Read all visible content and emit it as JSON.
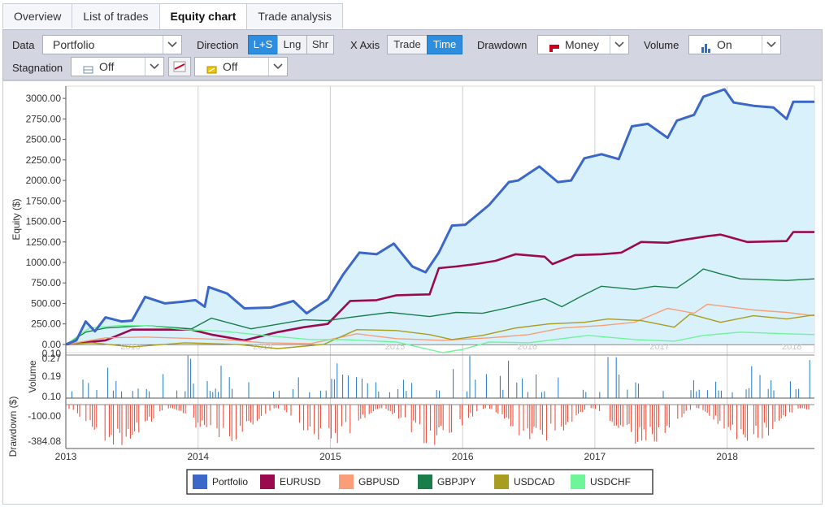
{
  "tabs": [
    {
      "label": "Overview",
      "active": false
    },
    {
      "label": "List of trades",
      "active": false
    },
    {
      "label": "Equity chart",
      "active": true
    },
    {
      "label": "Trade analysis",
      "active": false
    }
  ],
  "toolbar": {
    "data_label": "Data",
    "data_value": "Portfolio",
    "direction_label": "Direction",
    "direction_options": [
      "L+S",
      "Lng",
      "Shr"
    ],
    "direction_selected": "L+S",
    "xaxis_label": "X Axis",
    "xaxis_options": [
      "Trade",
      "Time"
    ],
    "xaxis_selected": "Time",
    "drawdown_label": "Drawdown",
    "drawdown_value": "Money",
    "volume_label": "Volume",
    "volume_value": "On",
    "stagnation_label": "Stagnation",
    "stagnation_value": "Off",
    "trend_value": "Off",
    "colors": {
      "selected": "#2d8ee0"
    }
  },
  "chart_data": [
    {
      "type": "area",
      "ylabel": "Equity ($)",
      "y_ticks": [
        "0.00",
        "250.00",
        "500.00",
        "750.00",
        "1000.00",
        "1250.00",
        "1500.00",
        "1750.00",
        "2000.00",
        "2250.00",
        "2500.00",
        "2750.00",
        "3000.00"
      ],
      "ylim": [
        -100,
        3150
      ],
      "xlim": [
        2013.0,
        2018.66
      ],
      "x_ticks": [
        "2013",
        "2014",
        "2015",
        "2016",
        "2017",
        "2018"
      ],
      "x_year_values": [
        2013,
        2014,
        2015,
        2016,
        2017,
        2018
      ],
      "watermark_labels": [
        "2013",
        "2014",
        "2015",
        "2016",
        "2017",
        "2018"
      ],
      "grid": true,
      "legend_position": "bottom-center",
      "series": [
        {
          "name": "Portfolio",
          "color": "#3a67c8",
          "points": [
            [
              2013.0,
              0
            ],
            [
              2013.08,
              50
            ],
            [
              2013.15,
              280
            ],
            [
              2013.22,
              160
            ],
            [
              2013.3,
              330
            ],
            [
              2013.42,
              280
            ],
            [
              2013.5,
              290
            ],
            [
              2013.6,
              580
            ],
            [
              2013.75,
              500
            ],
            [
              2013.88,
              520
            ],
            [
              2013.98,
              540
            ],
            [
              2014.05,
              460
            ],
            [
              2014.08,
              700
            ],
            [
              2014.22,
              620
            ],
            [
              2014.35,
              440
            ],
            [
              2014.55,
              450
            ],
            [
              2014.72,
              530
            ],
            [
              2014.82,
              380
            ],
            [
              2014.98,
              550
            ],
            [
              2015.1,
              860
            ],
            [
              2015.22,
              1120
            ],
            [
              2015.35,
              1100
            ],
            [
              2015.48,
              1230
            ],
            [
              2015.62,
              950
            ],
            [
              2015.72,
              880
            ],
            [
              2015.82,
              1120
            ],
            [
              2015.92,
              1450
            ],
            [
              2016.02,
              1460
            ],
            [
              2016.2,
              1700
            ],
            [
              2016.35,
              1980
            ],
            [
              2016.42,
              2000
            ],
            [
              2016.58,
              2170
            ],
            [
              2016.72,
              1980
            ],
            [
              2016.82,
              2000
            ],
            [
              2016.92,
              2270
            ],
            [
              2017.05,
              2320
            ],
            [
              2017.18,
              2260
            ],
            [
              2017.28,
              2660
            ],
            [
              2017.4,
              2690
            ],
            [
              2017.55,
              2520
            ],
            [
              2017.62,
              2730
            ],
            [
              2017.75,
              2800
            ],
            [
              2017.82,
              3020
            ],
            [
              2017.98,
              3110
            ],
            [
              2018.05,
              2950
            ],
            [
              2018.2,
              2910
            ],
            [
              2018.35,
              2890
            ],
            [
              2018.45,
              2750
            ],
            [
              2018.5,
              2960
            ],
            [
              2018.66,
              2960
            ]
          ]
        },
        {
          "name": "EURUSD",
          "color": "#9b0a4f",
          "points": [
            [
              2013.0,
              0
            ],
            [
              2013.3,
              50
            ],
            [
              2013.5,
              180
            ],
            [
              2013.95,
              180
            ],
            [
              2014.1,
              120
            ],
            [
              2014.35,
              50
            ],
            [
              2014.6,
              150
            ],
            [
              2014.8,
              210
            ],
            [
              2014.98,
              250
            ],
            [
              2015.15,
              530
            ],
            [
              2015.35,
              540
            ],
            [
              2015.5,
              600
            ],
            [
              2015.75,
              610
            ],
            [
              2015.82,
              930
            ],
            [
              2015.95,
              950
            ],
            [
              2016.1,
              980
            ],
            [
              2016.25,
              1020
            ],
            [
              2016.4,
              1100
            ],
            [
              2016.62,
              1070
            ],
            [
              2016.68,
              980
            ],
            [
              2016.85,
              1090
            ],
            [
              2017.05,
              1100
            ],
            [
              2017.2,
              1120
            ],
            [
              2017.35,
              1250
            ],
            [
              2017.55,
              1240
            ],
            [
              2017.65,
              1270
            ],
            [
              2017.85,
              1320
            ],
            [
              2017.95,
              1340
            ],
            [
              2018.15,
              1250
            ],
            [
              2018.45,
              1260
            ],
            [
              2018.5,
              1370
            ],
            [
              2018.66,
              1370
            ]
          ]
        },
        {
          "name": "GBPUSD",
          "color": "#f99e78",
          "points": [
            [
              2013.0,
              0
            ],
            [
              2013.3,
              80
            ],
            [
              2013.6,
              90
            ],
            [
              2014.2,
              60
            ],
            [
              2014.5,
              20
            ],
            [
              2014.85,
              10
            ],
            [
              2015.2,
              130
            ],
            [
              2015.5,
              70
            ],
            [
              2015.85,
              50
            ],
            [
              2016.2,
              80
            ],
            [
              2016.5,
              120
            ],
            [
              2016.75,
              200
            ],
            [
              2017.05,
              230
            ],
            [
              2017.3,
              270
            ],
            [
              2017.55,
              440
            ],
            [
              2017.75,
              380
            ],
            [
              2017.85,
              490
            ],
            [
              2018.2,
              420
            ],
            [
              2018.45,
              390
            ],
            [
              2018.66,
              350
            ]
          ]
        },
        {
          "name": "GBPJPY",
          "color": "#1a7e4b",
          "points": [
            [
              2013.0,
              0
            ],
            [
              2013.15,
              150
            ],
            [
              2013.3,
              200
            ],
            [
              2013.6,
              230
            ],
            [
              2013.95,
              190
            ],
            [
              2014.1,
              320
            ],
            [
              2014.4,
              190
            ],
            [
              2014.8,
              300
            ],
            [
              2014.98,
              290
            ],
            [
              2015.15,
              330
            ],
            [
              2015.45,
              390
            ],
            [
              2015.75,
              340
            ],
            [
              2015.95,
              390
            ],
            [
              2016.15,
              380
            ],
            [
              2016.35,
              450
            ],
            [
              2016.62,
              560
            ],
            [
              2016.75,
              460
            ],
            [
              2016.9,
              590
            ],
            [
              2017.05,
              710
            ],
            [
              2017.3,
              670
            ],
            [
              2017.45,
              710
            ],
            [
              2017.62,
              690
            ],
            [
              2017.75,
              830
            ],
            [
              2017.82,
              920
            ],
            [
              2017.95,
              860
            ],
            [
              2018.1,
              800
            ],
            [
              2018.45,
              780
            ],
            [
              2018.66,
              800
            ]
          ]
        },
        {
          "name": "USDCAD",
          "color": "#a89d1e",
          "points": [
            [
              2013.0,
              0
            ],
            [
              2013.2,
              20
            ],
            [
              2013.5,
              -30
            ],
            [
              2013.9,
              20
            ],
            [
              2014.3,
              0
            ],
            [
              2014.6,
              -50
            ],
            [
              2014.95,
              0
            ],
            [
              2015.2,
              180
            ],
            [
              2015.5,
              170
            ],
            [
              2015.75,
              120
            ],
            [
              2015.92,
              60
            ],
            [
              2016.15,
              110
            ],
            [
              2016.4,
              200
            ],
            [
              2016.65,
              250
            ],
            [
              2016.92,
              270
            ],
            [
              2017.1,
              310
            ],
            [
              2017.35,
              290
            ],
            [
              2017.6,
              210
            ],
            [
              2017.72,
              370
            ],
            [
              2017.95,
              270
            ],
            [
              2018.2,
              350
            ],
            [
              2018.45,
              310
            ],
            [
              2018.66,
              360
            ]
          ]
        },
        {
          "name": "USDCHF",
          "color": "#6ef59a",
          "points": [
            [
              2013.0,
              0
            ],
            [
              2013.18,
              200
            ],
            [
              2013.4,
              230
            ],
            [
              2013.6,
              230
            ],
            [
              2013.9,
              180
            ],
            [
              2014.2,
              160
            ],
            [
              2014.5,
              110
            ],
            [
              2014.85,
              60
            ],
            [
              2015.1,
              60
            ],
            [
              2015.5,
              30
            ],
            [
              2015.85,
              -100
            ],
            [
              2016.0,
              -60
            ],
            [
              2016.2,
              30
            ],
            [
              2016.5,
              20
            ],
            [
              2016.75,
              70
            ],
            [
              2016.95,
              110
            ],
            [
              2017.3,
              60
            ],
            [
              2017.6,
              40
            ],
            [
              2017.82,
              110
            ],
            [
              2018.1,
              150
            ],
            [
              2018.45,
              130
            ],
            [
              2018.66,
              120
            ]
          ]
        }
      ]
    },
    {
      "type": "bar",
      "ylabel": "Volume",
      "y_ticks": [
        "0.10",
        "0.19",
        "0.27",
        "0.10"
      ],
      "ylim": [
        0.1,
        0.4
      ],
      "bar_color": "#1f77c4"
    },
    {
      "type": "bar",
      "ylabel": "Drawdown ($)",
      "y_ticks": [
        "-100.00",
        "-384.08"
      ],
      "ylim": [
        -384.08,
        0
      ],
      "bar_color": "#e8432f"
    }
  ],
  "legend": [
    {
      "name": "Portfolio",
      "color": "#3a67c8"
    },
    {
      "name": "EURUSD",
      "color": "#9b0a4f"
    },
    {
      "name": "GBPUSD",
      "color": "#f99e78"
    },
    {
      "name": "GBPJPY",
      "color": "#1a7e4b"
    },
    {
      "name": "USDCAD",
      "color": "#a89d1e"
    },
    {
      "name": "USDCHF",
      "color": "#6ef59a"
    }
  ]
}
